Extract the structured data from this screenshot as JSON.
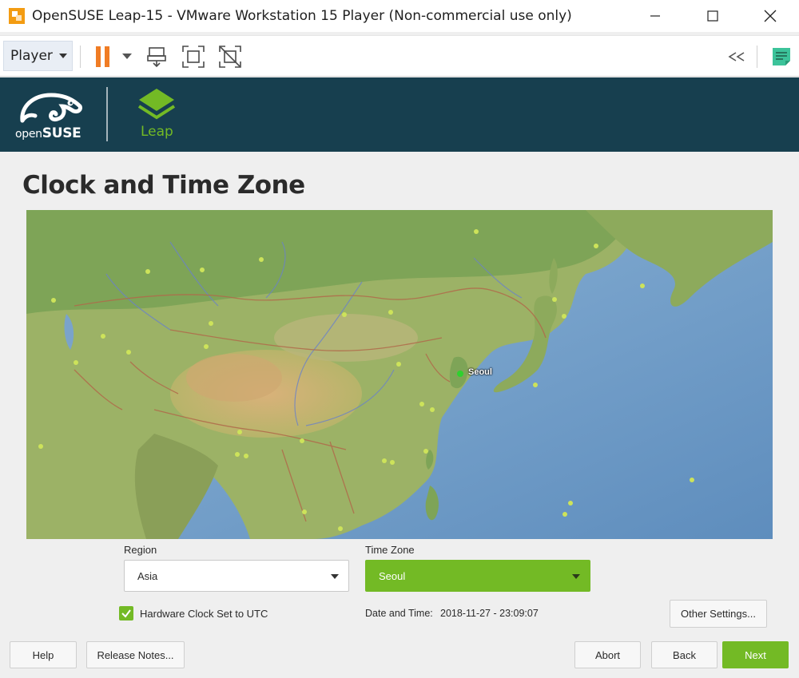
{
  "window": {
    "title": "OpenSUSE Leap-15 - VMware Workstation 15 Player (Non-commercial use only)"
  },
  "toolbar": {
    "player_label": "Player"
  },
  "header": {
    "brand_small": "open",
    "brand_big": "SUSE",
    "product": "Leap"
  },
  "page": {
    "title": "Clock and Time Zone"
  },
  "map": {
    "selected_city": "Seoul"
  },
  "region": {
    "label": "Region",
    "value": "Asia"
  },
  "timezone": {
    "label": "Time Zone",
    "value": "Seoul"
  },
  "hardware_clock": {
    "label": "Hardware Clock Set to UTC",
    "checked": true
  },
  "datetime": {
    "label": "Date and Time:",
    "value": "2018-11-27 - 23:09:07"
  },
  "buttons": {
    "other_settings": "Other Settings...",
    "help": "Help",
    "release_notes": "Release Notes...",
    "abort": "Abort",
    "back": "Back",
    "next": "Next"
  },
  "colors": {
    "accent": "#73ba25",
    "header_bg": "#173f4f",
    "pause_icon": "#f07c24"
  }
}
